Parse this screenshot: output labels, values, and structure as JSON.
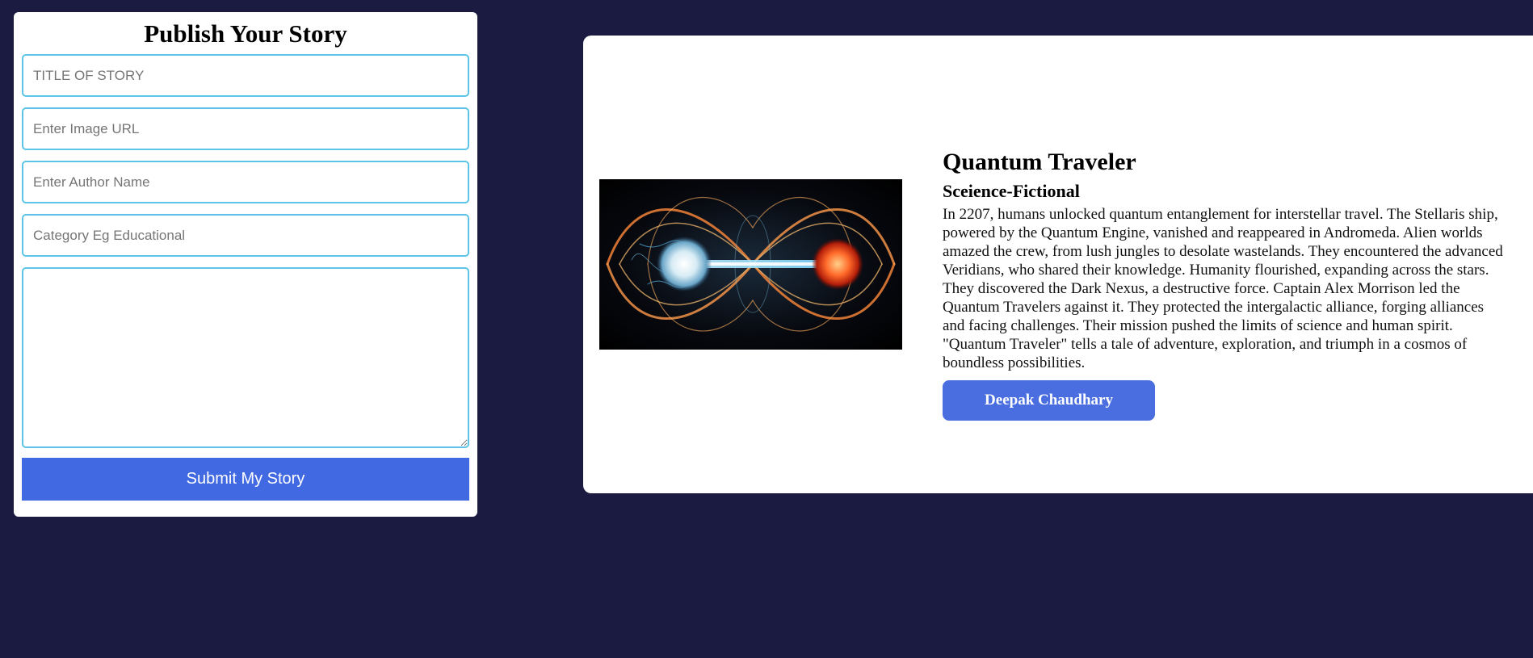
{
  "form": {
    "title": "Publish Your Story",
    "fields": {
      "title_placeholder": "TITLE OF STORY",
      "image_url_placeholder": "Enter Image URL",
      "author_placeholder": "Enter Author Name",
      "category_placeholder": "Category Eg Educational",
      "content_value": ""
    },
    "submit_label": "Submit My Story"
  },
  "story": {
    "image_icon": "quantum-entanglement-image",
    "title": "Quantum Traveler",
    "category": "Sceience-Fictional",
    "body": "In 2207, humans unlocked quantum entanglement for interstellar travel. The Stellaris ship, powered by the Quantum Engine, vanished and reappeared in Andromeda. Alien worlds amazed the crew, from lush jungles to desolate wastelands. They encountered the advanced Veridians, who shared their knowledge. Humanity flourished, expanding across the stars. They discovered the Dark Nexus, a destructive force. Captain Alex Morrison led the Quantum Travelers against it. They protected the intergalactic alliance, forging alliances and facing challenges. Their mission pushed the limits of science and human spirit. \"Quantum Traveler\" tells a tale of adventure, exploration, and triumph in a cosmos of boundless possibilities.",
    "author": "Deepak Chaudhary"
  },
  "colors": {
    "page_background": "#1b1a40",
    "card_background": "#ffffff",
    "field_border": "#5cc4e6",
    "button_accent": "#4169e1"
  }
}
